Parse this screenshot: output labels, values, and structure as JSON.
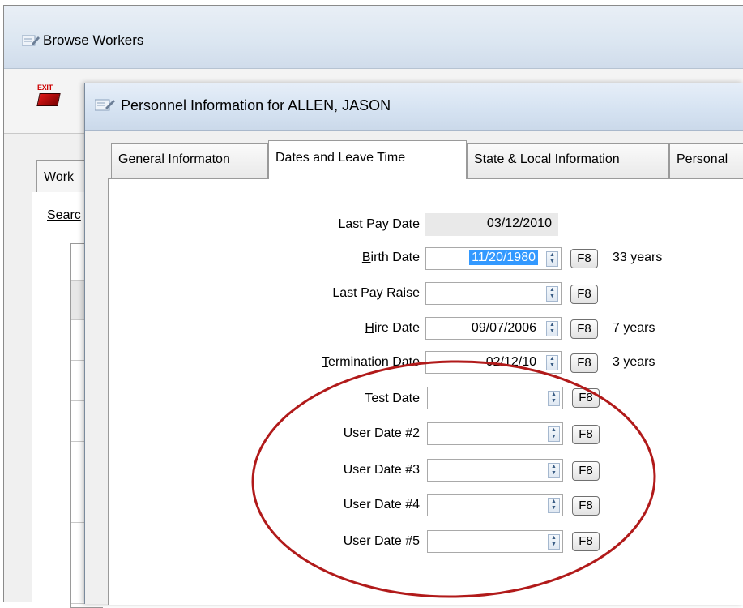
{
  "background_window": {
    "title": "Browse Workers",
    "exit_label": "EXIT",
    "tab_label": "Work",
    "search_label": "Searc"
  },
  "dialog": {
    "title": "Personnel Information for ALLEN, JASON",
    "tabs": [
      {
        "label": "General Informaton",
        "active": false
      },
      {
        "label": "Dates and Leave Time",
        "active": true
      },
      {
        "label": "State & Local Information",
        "active": false
      },
      {
        "label": "Personal",
        "active": false
      }
    ],
    "fields": {
      "last_pay_date": {
        "label_pre": "",
        "label_u": "L",
        "label_post": "ast Pay Date",
        "value": "03/12/2010"
      },
      "birth_date": {
        "label_pre": "",
        "label_u": "B",
        "label_post": "irth Date",
        "value": "11/20/1980",
        "age": "33 years",
        "button": "F8"
      },
      "last_pay_raise": {
        "label_pre": "Last Pay ",
        "label_u": "R",
        "label_post": "aise",
        "value": "",
        "button": "F8"
      },
      "hire_date": {
        "label_pre": "",
        "label_u": "H",
        "label_post": "ire Date",
        "value": "09/07/2006",
        "age": "7 years",
        "button": "F8"
      },
      "termination_date": {
        "label_pre": "",
        "label_u": "T",
        "label_post": "ermination Date",
        "value": "02/12/10",
        "age": "3 years",
        "button": "F8"
      },
      "test_date": {
        "label": "Test Date",
        "value": "",
        "button": "F8"
      },
      "user_date_2": {
        "label": "User Date #2",
        "value": "",
        "button": "F8"
      },
      "user_date_3": {
        "label": "User Date #3",
        "value": "",
        "button": "F8"
      },
      "user_date_4": {
        "label": "User Date #4",
        "value": "",
        "button": "F8"
      },
      "user_date_5": {
        "label": "User Date #5",
        "value": "",
        "button": "F8"
      }
    }
  },
  "annotation": {
    "shape": "ellipse",
    "color": "#b11a1a"
  }
}
